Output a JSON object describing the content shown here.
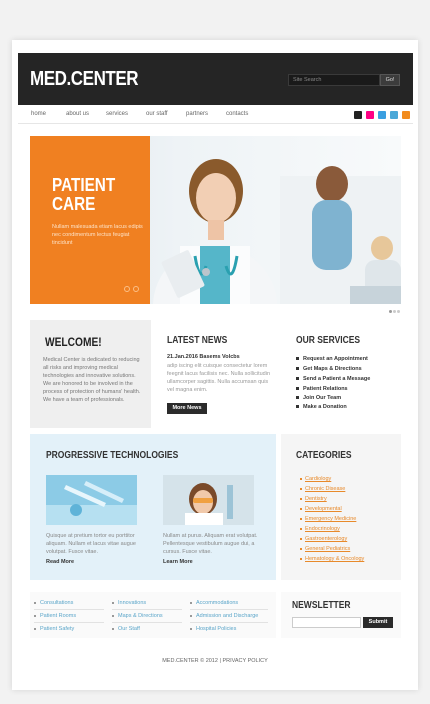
{
  "header": {
    "logo": "MED.CENTER",
    "search_placeholder": "Site Search",
    "go_label": "Go!"
  },
  "nav": {
    "items": [
      "home",
      "about us",
      "services",
      "our staff",
      "partners",
      "contacts"
    ]
  },
  "hero": {
    "title_line1": "PATIENT",
    "title_line2": "CARE",
    "text": "Nullam malesuada etiam lacus edipis nec condimentum lectus feugiat tincidunt"
  },
  "welcome": {
    "title": "WELCOME!",
    "text": "Medical Center is dedicated to reducing all risks and improving medical technologies and innovative solutions. We are honored to be involved in the process of protection of humans' health. We have a team of professionals."
  },
  "news": {
    "title": "LATEST NEWS",
    "date_title": "21.Jan.2016 Basems Volcbs",
    "text": "adip iscing elit cuisque consectetur lorem feegnit lacus facilisis nec. Nulla sollicitudin ullamcorper sagittis. Nulla accumsan quis vel magna enim.",
    "more_label": "More News"
  },
  "services": {
    "title": "OUR SERVICES",
    "items": [
      "Request an Appointment",
      "Get Maps & Directions",
      "Send a Patient a Message",
      "Patient Relations",
      "Join Our Team",
      "Make a Donation"
    ]
  },
  "progressive": {
    "title": "PROGRESSIVE TECHNOLOGIES",
    "col1_text": "Quisque at pretium tortor eu porttitor aliquam. Nullam et lacus vitae augue volutpat. Fusce vitae.",
    "col2_text": "Nullam at purus. Aliquam erat volutpat. Pellentesque vestibulum augue dui, a cursus. Fusce vitae.",
    "read_more": "Read More",
    "learn_more": "Learn More"
  },
  "categories": {
    "title": "CATEGORIES",
    "items": [
      "Cardiology",
      "Chronic Disease",
      "Dentistry",
      "Developmental",
      "Emergency Medicine",
      "Endocrinology",
      "Gastroenterology",
      "General Pediatrics",
      "Hematology & Oncology"
    ]
  },
  "footer_links": {
    "col1": [
      "Consultations",
      "Patient Rooms",
      "Patient Safety"
    ],
    "col2": [
      "Innovations",
      "Maps & Directions",
      "Our Staff"
    ],
    "col3": [
      "Accommodations",
      "Admission and Discharge",
      "Hospital Policies"
    ]
  },
  "newsletter": {
    "title": "NEWSLETTER",
    "submit_label": "Submit"
  },
  "footer": {
    "copyright": "MED.CENTER © 2012",
    "separator": "|",
    "privacy": "PRIVACY POLICY"
  },
  "colors": {
    "accent": "#f08021",
    "header": "#252525",
    "light_blue": "#e3f1f9",
    "link_blue": "#5aa5c9"
  }
}
